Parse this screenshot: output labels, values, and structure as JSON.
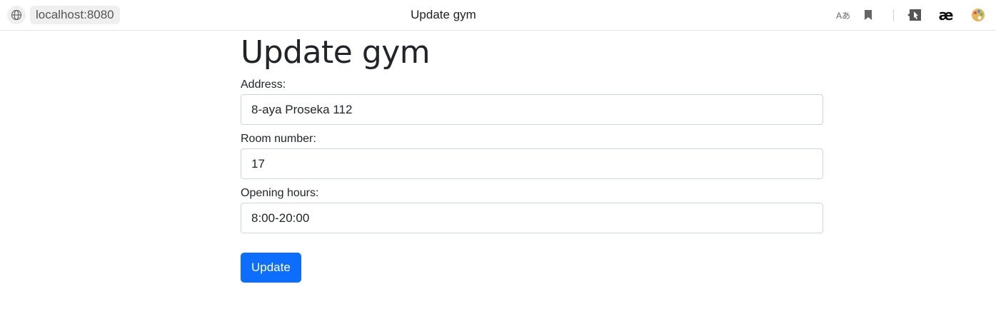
{
  "browser": {
    "url": "localhost:8080",
    "tab_title": "Update gym",
    "icons": [
      "globe-icon",
      "translate-icon",
      "bookmark-icon",
      "extension-cursor-icon",
      "ae-extension-icon",
      "palette-icon"
    ],
    "translate_glyph": "Aあ",
    "ae_glyph": "æ"
  },
  "page": {
    "title": "Update gym",
    "fields": [
      {
        "label": "Address:",
        "value": "8-aya Proseka 112"
      },
      {
        "label": "Room number:",
        "value": "17"
      },
      {
        "label": "Opening hours:",
        "value": "8:00-20:00"
      }
    ],
    "submit_label": "Update"
  },
  "colors": {
    "primary": "#0d6efd",
    "text": "#212529",
    "input_border": "#ced4da"
  }
}
